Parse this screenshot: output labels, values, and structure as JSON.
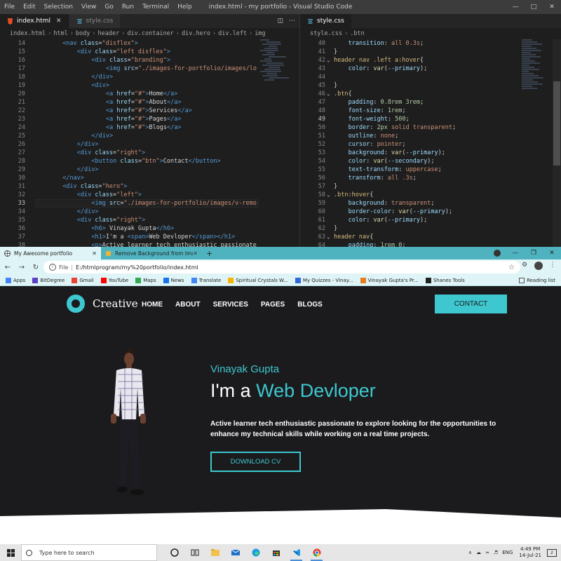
{
  "vscode": {
    "menu": [
      "File",
      "Edit",
      "Selection",
      "View",
      "Go",
      "Run",
      "Terminal",
      "Help"
    ],
    "window_title": "index.html - my portfolio - Visual Studio Code",
    "left_tabs": [
      {
        "label": "index.html",
        "active": true
      },
      {
        "label": "style.css",
        "active": false
      }
    ],
    "left_breadcrumb": [
      "index.html",
      "html",
      "body",
      "header",
      "div.container",
      "div.hero",
      "div.left",
      "img"
    ],
    "right_tabs": [
      {
        "label": "style.css",
        "active": true
      }
    ],
    "right_breadcrumb": [
      "style.css",
      ".btn"
    ],
    "left_lines": [
      {
        "n": "14",
        "indent": 8,
        "tokens": [
          [
            "t",
            "<nav "
          ],
          [
            "a",
            "class"
          ],
          [
            "w",
            "="
          ],
          [
            "s",
            "\"disflex\""
          ],
          [
            "t",
            ">"
          ]
        ]
      },
      {
        "n": "15",
        "indent": 12,
        "tokens": [
          [
            "t",
            "<div "
          ],
          [
            "a",
            "class"
          ],
          [
            "w",
            "="
          ],
          [
            "s",
            "\"left disflex\""
          ],
          [
            "t",
            ">"
          ]
        ]
      },
      {
        "n": "16",
        "indent": 16,
        "tokens": [
          [
            "t",
            "<div "
          ],
          [
            "a",
            "class"
          ],
          [
            "w",
            "="
          ],
          [
            "s",
            "\"branding\""
          ],
          [
            "t",
            ">"
          ]
        ]
      },
      {
        "n": "17",
        "indent": 20,
        "tokens": [
          [
            "t",
            "<img "
          ],
          [
            "a",
            "src"
          ],
          [
            "w",
            "="
          ],
          [
            "s",
            "\"./images-for-portfolio/images/lo"
          ]
        ]
      },
      {
        "n": "18",
        "indent": 16,
        "tokens": [
          [
            "t",
            "</div>"
          ]
        ]
      },
      {
        "n": "19",
        "indent": 16,
        "tokens": [
          [
            "t",
            "<div>"
          ]
        ]
      },
      {
        "n": "20",
        "indent": 20,
        "tokens": [
          [
            "t",
            "<a "
          ],
          [
            "a",
            "href"
          ],
          [
            "w",
            "="
          ],
          [
            "s",
            "\"#\""
          ],
          [
            "t",
            ">"
          ],
          [
            "w",
            "Home"
          ],
          [
            "t",
            "</a>"
          ]
        ]
      },
      {
        "n": "21",
        "indent": 20,
        "tokens": [
          [
            "t",
            "<a "
          ],
          [
            "a",
            "href"
          ],
          [
            "w",
            "="
          ],
          [
            "s",
            "\"#\""
          ],
          [
            "t",
            ">"
          ],
          [
            "w",
            "About"
          ],
          [
            "t",
            "</a>"
          ]
        ]
      },
      {
        "n": "22",
        "indent": 20,
        "tokens": [
          [
            "t",
            "<a "
          ],
          [
            "a",
            "href"
          ],
          [
            "w",
            "="
          ],
          [
            "s",
            "\"#\""
          ],
          [
            "t",
            ">"
          ],
          [
            "w",
            "Services"
          ],
          [
            "t",
            "</a>"
          ]
        ]
      },
      {
        "n": "23",
        "indent": 20,
        "tokens": [
          [
            "t",
            "<a "
          ],
          [
            "a",
            "href"
          ],
          [
            "w",
            "="
          ],
          [
            "s",
            "\"#\""
          ],
          [
            "t",
            ">"
          ],
          [
            "w",
            "Pages"
          ],
          [
            "t",
            "</a>"
          ]
        ]
      },
      {
        "n": "24",
        "indent": 20,
        "tokens": [
          [
            "t",
            "<a "
          ],
          [
            "a",
            "href"
          ],
          [
            "w",
            "="
          ],
          [
            "s",
            "\"#\""
          ],
          [
            "t",
            ">"
          ],
          [
            "w",
            "Blogs"
          ],
          [
            "t",
            "</a>"
          ]
        ]
      },
      {
        "n": "25",
        "indent": 16,
        "tokens": [
          [
            "t",
            "</div>"
          ]
        ]
      },
      {
        "n": "26",
        "indent": 12,
        "tokens": [
          [
            "t",
            "</div>"
          ]
        ]
      },
      {
        "n": "27",
        "indent": 12,
        "tokens": [
          [
            "t",
            "<div "
          ],
          [
            "a",
            "class"
          ],
          [
            "w",
            "="
          ],
          [
            "s",
            "\"right\""
          ],
          [
            "t",
            ">"
          ]
        ]
      },
      {
        "n": "28",
        "indent": 16,
        "tokens": [
          [
            "t",
            "<button "
          ],
          [
            "a",
            "class"
          ],
          [
            "w",
            "="
          ],
          [
            "s",
            "\"btn\""
          ],
          [
            "t",
            ">"
          ],
          [
            "w",
            "Contact"
          ],
          [
            "t",
            "</button>"
          ]
        ]
      },
      {
        "n": "29",
        "indent": 12,
        "tokens": [
          [
            "t",
            "</div>"
          ]
        ]
      },
      {
        "n": "30",
        "indent": 8,
        "tokens": [
          [
            "t",
            "</nav>"
          ]
        ]
      },
      {
        "n": "31",
        "indent": 8,
        "tokens": [
          [
            "t",
            "<div "
          ],
          [
            "a",
            "class"
          ],
          [
            "w",
            "="
          ],
          [
            "s",
            "\"hero\""
          ],
          [
            "t",
            ">"
          ]
        ]
      },
      {
        "n": "32",
        "indent": 12,
        "tokens": [
          [
            "t",
            "<div "
          ],
          [
            "a",
            "class"
          ],
          [
            "w",
            "="
          ],
          [
            "s",
            "\"left\""
          ],
          [
            "t",
            ">"
          ]
        ]
      },
      {
        "n": "33",
        "indent": 16,
        "tokens": [
          [
            "t",
            "<img "
          ],
          [
            "a",
            "src"
          ],
          [
            "w",
            "="
          ],
          [
            "s",
            "\"./images-for-portfolio/images/v-remo"
          ]
        ]
      },
      {
        "n": "34",
        "indent": 12,
        "tokens": [
          [
            "t",
            "</div>"
          ]
        ]
      },
      {
        "n": "35",
        "indent": 12,
        "tokens": [
          [
            "t",
            "<div "
          ],
          [
            "a",
            "class"
          ],
          [
            "w",
            "="
          ],
          [
            "s",
            "\"right\""
          ],
          [
            "t",
            ">"
          ]
        ]
      },
      {
        "n": "36",
        "indent": 16,
        "tokens": [
          [
            "t",
            "<h6>"
          ],
          [
            "w",
            " Vinayak Gupta"
          ],
          [
            "t",
            "</h6>"
          ]
        ]
      },
      {
        "n": "37",
        "indent": 16,
        "tokens": [
          [
            "t",
            "<h1>"
          ],
          [
            "w",
            "I'm a "
          ],
          [
            "t",
            "<span>"
          ],
          [
            "w",
            "Web Devloper"
          ],
          [
            "t",
            "</span></h1>"
          ]
        ]
      },
      {
        "n": "38",
        "indent": 16,
        "tokens": [
          [
            "t",
            "<p>"
          ],
          [
            "w",
            "Active learner tech enthusiastic passionate"
          ]
        ]
      }
    ],
    "right_lines": [
      {
        "n": "40",
        "indent": 4,
        "tokens": [
          [
            "pr",
            "transition"
          ],
          [
            "w",
            ": "
          ],
          [
            "v",
            "all 0.3s"
          ],
          [
            "w",
            ";"
          ]
        ]
      },
      {
        "n": "41",
        "indent": 0,
        "tokens": [
          [
            "w",
            "}"
          ]
        ]
      },
      {
        "n": "42",
        "indent": 0,
        "tokens": [
          [
            "sel",
            "header nav .left a:hover"
          ],
          [
            "w",
            "{"
          ]
        ]
      },
      {
        "n": "43",
        "indent": 4,
        "tokens": [
          [
            "pr",
            "color"
          ],
          [
            "w",
            ": "
          ],
          [
            "fn",
            "var"
          ],
          [
            "w",
            "("
          ],
          [
            "pr",
            "--primary"
          ],
          [
            "w",
            ");"
          ]
        ]
      },
      {
        "n": "44",
        "indent": 0,
        "tokens": []
      },
      {
        "n": "45",
        "indent": 0,
        "tokens": [
          [
            "w",
            "}"
          ]
        ]
      },
      {
        "n": "46",
        "indent": 0,
        "tokens": [
          [
            "sel",
            ".btn"
          ],
          [
            "w",
            "{"
          ]
        ]
      },
      {
        "n": "47",
        "indent": 4,
        "tokens": [
          [
            "pr",
            "padding"
          ],
          [
            "w",
            ": "
          ],
          [
            "nm",
            "0.8rem 3rem"
          ],
          [
            "w",
            ";"
          ]
        ]
      },
      {
        "n": "48",
        "indent": 4,
        "tokens": [
          [
            "pr",
            "font-size"
          ],
          [
            "w",
            ": "
          ],
          [
            "nm",
            "1rem"
          ],
          [
            "w",
            ";"
          ]
        ]
      },
      {
        "n": "49",
        "indent": 4,
        "tokens": [
          [
            "pr",
            "font-weight"
          ],
          [
            "w",
            ": "
          ],
          [
            "nm",
            "500"
          ],
          [
            "w",
            ";"
          ]
        ]
      },
      {
        "n": "50",
        "indent": 4,
        "tokens": [
          [
            "pr",
            "border"
          ],
          [
            "w",
            ": "
          ],
          [
            "nm",
            "2px"
          ],
          [
            "v",
            " solid transparent"
          ],
          [
            "w",
            ";"
          ]
        ]
      },
      {
        "n": "51",
        "indent": 4,
        "tokens": [
          [
            "pr",
            "outline"
          ],
          [
            "w",
            ": "
          ],
          [
            "v",
            "none"
          ],
          [
            "w",
            ";"
          ]
        ]
      },
      {
        "n": "52",
        "indent": 4,
        "tokens": [
          [
            "pr",
            "cursor"
          ],
          [
            "w",
            ": "
          ],
          [
            "v",
            "pointer"
          ],
          [
            "w",
            ";"
          ]
        ]
      },
      {
        "n": "53",
        "indent": 4,
        "tokens": [
          [
            "pr",
            "background"
          ],
          [
            "w",
            ": "
          ],
          [
            "fn",
            "var"
          ],
          [
            "w",
            "("
          ],
          [
            "pr",
            "--primary"
          ],
          [
            "w",
            ");"
          ]
        ]
      },
      {
        "n": "54",
        "indent": 4,
        "tokens": [
          [
            "pr",
            "color"
          ],
          [
            "w",
            ": "
          ],
          [
            "fn",
            "var"
          ],
          [
            "w",
            "("
          ],
          [
            "pr",
            "--secondary"
          ],
          [
            "w",
            ");"
          ]
        ]
      },
      {
        "n": "55",
        "indent": 4,
        "tokens": [
          [
            "pr",
            "text-transform"
          ],
          [
            "w",
            ": "
          ],
          [
            "v",
            "uppercase"
          ],
          [
            "w",
            ";"
          ]
        ]
      },
      {
        "n": "56",
        "indent": 4,
        "tokens": [
          [
            "pr",
            "transform"
          ],
          [
            "w",
            ": "
          ],
          [
            "v",
            "all .3s"
          ],
          [
            "w",
            ";"
          ]
        ]
      },
      {
        "n": "57",
        "indent": 0,
        "tokens": [
          [
            "w",
            "}"
          ]
        ]
      },
      {
        "n": "58",
        "indent": 0,
        "tokens": [
          [
            "sel",
            ".btn:hover"
          ],
          [
            "w",
            "{"
          ]
        ]
      },
      {
        "n": "59",
        "indent": 4,
        "tokens": [
          [
            "pr",
            "background"
          ],
          [
            "w",
            ": "
          ],
          [
            "v",
            "transparent"
          ],
          [
            "w",
            ";"
          ]
        ]
      },
      {
        "n": "60",
        "indent": 4,
        "tokens": [
          [
            "pr",
            "border-color"
          ],
          [
            "w",
            ": "
          ],
          [
            "fn",
            "var"
          ],
          [
            "w",
            "("
          ],
          [
            "pr",
            "--primary"
          ],
          [
            "w",
            ");"
          ]
        ]
      },
      {
        "n": "61",
        "indent": 4,
        "tokens": [
          [
            "pr",
            "color"
          ],
          [
            "w",
            ": "
          ],
          [
            "fn",
            "var"
          ],
          [
            "w",
            "("
          ],
          [
            "pr",
            "--primary"
          ],
          [
            "w",
            ");"
          ]
        ]
      },
      {
        "n": "62",
        "indent": 0,
        "tokens": [
          [
            "w",
            "}"
          ]
        ]
      },
      {
        "n": "63",
        "indent": 0,
        "tokens": [
          [
            "sel",
            "header nav"
          ],
          [
            "w",
            "{"
          ]
        ]
      },
      {
        "n": "64",
        "indent": 4,
        "tokens": [
          [
            "pr",
            "padding"
          ],
          [
            "w",
            ": "
          ],
          [
            "nm",
            "1rem 0"
          ],
          [
            "w",
            ";"
          ]
        ]
      }
    ]
  },
  "chrome": {
    "tabs": [
      {
        "label": "My Awesome portfolio",
        "active": true
      },
      {
        "label": "Remove Background from Image",
        "active": false
      }
    ],
    "url_scheme": "File",
    "url": "E:/htmlprogram/my%20portfolio/index.html",
    "bookmarks": [
      "Apps",
      "BitDegree",
      "Gmail",
      "YouTube",
      "Maps",
      "News",
      "Translate",
      "Spiritual Crystals W...",
      "My Quizzes - Vinay...",
      "Vinayak Gupta's Pr...",
      "Shanes Tools"
    ],
    "reading_list": "Reading list"
  },
  "site": {
    "logo_text": "Creative",
    "nav": [
      "HOME",
      "ABOUT",
      "SERVICES",
      "PAGES",
      "BLOGS"
    ],
    "contact_button": "Contact",
    "hero_name": "Vinayak Gupta",
    "hero_title_prefix": "I'm a ",
    "hero_title_highlight": "Web Devloper",
    "hero_description": "Active learner tech enthusiastic passionate to explore looking for the opportunities to enhance my technical skills while working on a real time projects.",
    "download_button": "Download CV",
    "primary_color": "#3ec7cf"
  },
  "taskbar": {
    "search_placeholder": "Type here to search",
    "language": "ENG",
    "time": "4:49 PM",
    "date": "14-Jul-21"
  }
}
